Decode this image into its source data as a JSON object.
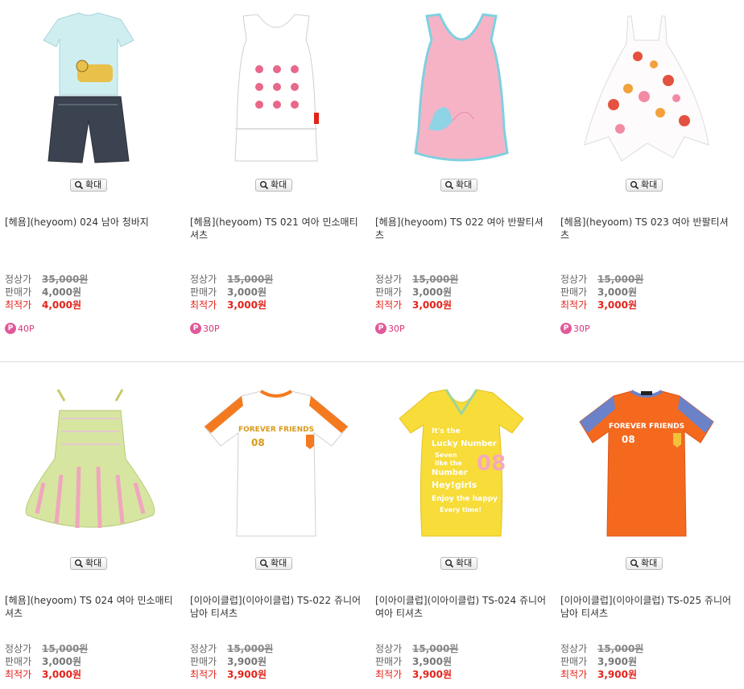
{
  "labels": {
    "zoom": "확대",
    "list_price": "정상가",
    "sale_price": "판매가",
    "best_price": "최적가"
  },
  "products": [
    {
      "name": "[헤욤](heyoom) 024 남아 청바지",
      "list_price": "35,000원",
      "sale_price": "4,000원",
      "best_price": "4,000원",
      "points": "40P",
      "image": "boy-tee-jean-shorts"
    },
    {
      "name": "[헤욤](heyoom) TS 021 여아 민소매티셔츠",
      "list_price": "15,000원",
      "sale_price": "3,000원",
      "best_price": "3,000원",
      "points": "30P",
      "image": "white-butterfly-tank"
    },
    {
      "name": "[헤욤](heyoom) TS 022 여아 반팔티셔츠",
      "list_price": "15,000원",
      "sale_price": "3,000원",
      "best_price": "3,000원",
      "points": "30P",
      "image": "pink-vneck-top"
    },
    {
      "name": "[헤욤](heyoom) TS 023 여아 반팔티셔츠",
      "list_price": "15,000원",
      "sale_price": "3,000원",
      "best_price": "3,000원",
      "points": "30P",
      "image": "floral-dress-top"
    },
    {
      "name": "[헤욤](heyoom) TS 024 여아 민소매티셔츠",
      "list_price": "15,000원",
      "sale_price": "3,000원",
      "best_price": "3,000원",
      "image": "striped-smock-dress"
    },
    {
      "name": "[이아이클럽](이아이클럽) TS-022 쥬니어 남아 티셔츠",
      "list_price": "15,000원",
      "sale_price": "3,900원",
      "best_price": "3,900원",
      "image": "white-forever-friends-tee"
    },
    {
      "name": "[이아이클럽](이아이클럽) TS-024 쥬니어 여아 티셔츠",
      "list_price": "15,000원",
      "sale_price": "3,900원",
      "best_price": "3,900원",
      "image": "yellow-lucky-number-tee"
    },
    {
      "name": "[이아이클럽](이아이클럽) TS-025 쥬니어 남아 티셔츠",
      "list_price": "15,000원",
      "sale_price": "3,900원",
      "best_price": "3,900원",
      "image": "orange-forever-friends-tee"
    }
  ],
  "artwork": {
    "tee1": [
      "FOREVER FRIENDS",
      "08"
    ],
    "tee2": [
      "It's the",
      "Lucky Number",
      "Seven",
      "like the",
      "Number",
      "08",
      "Hey!girls",
      "Enjoy the happy",
      "Every time!"
    ]
  }
}
